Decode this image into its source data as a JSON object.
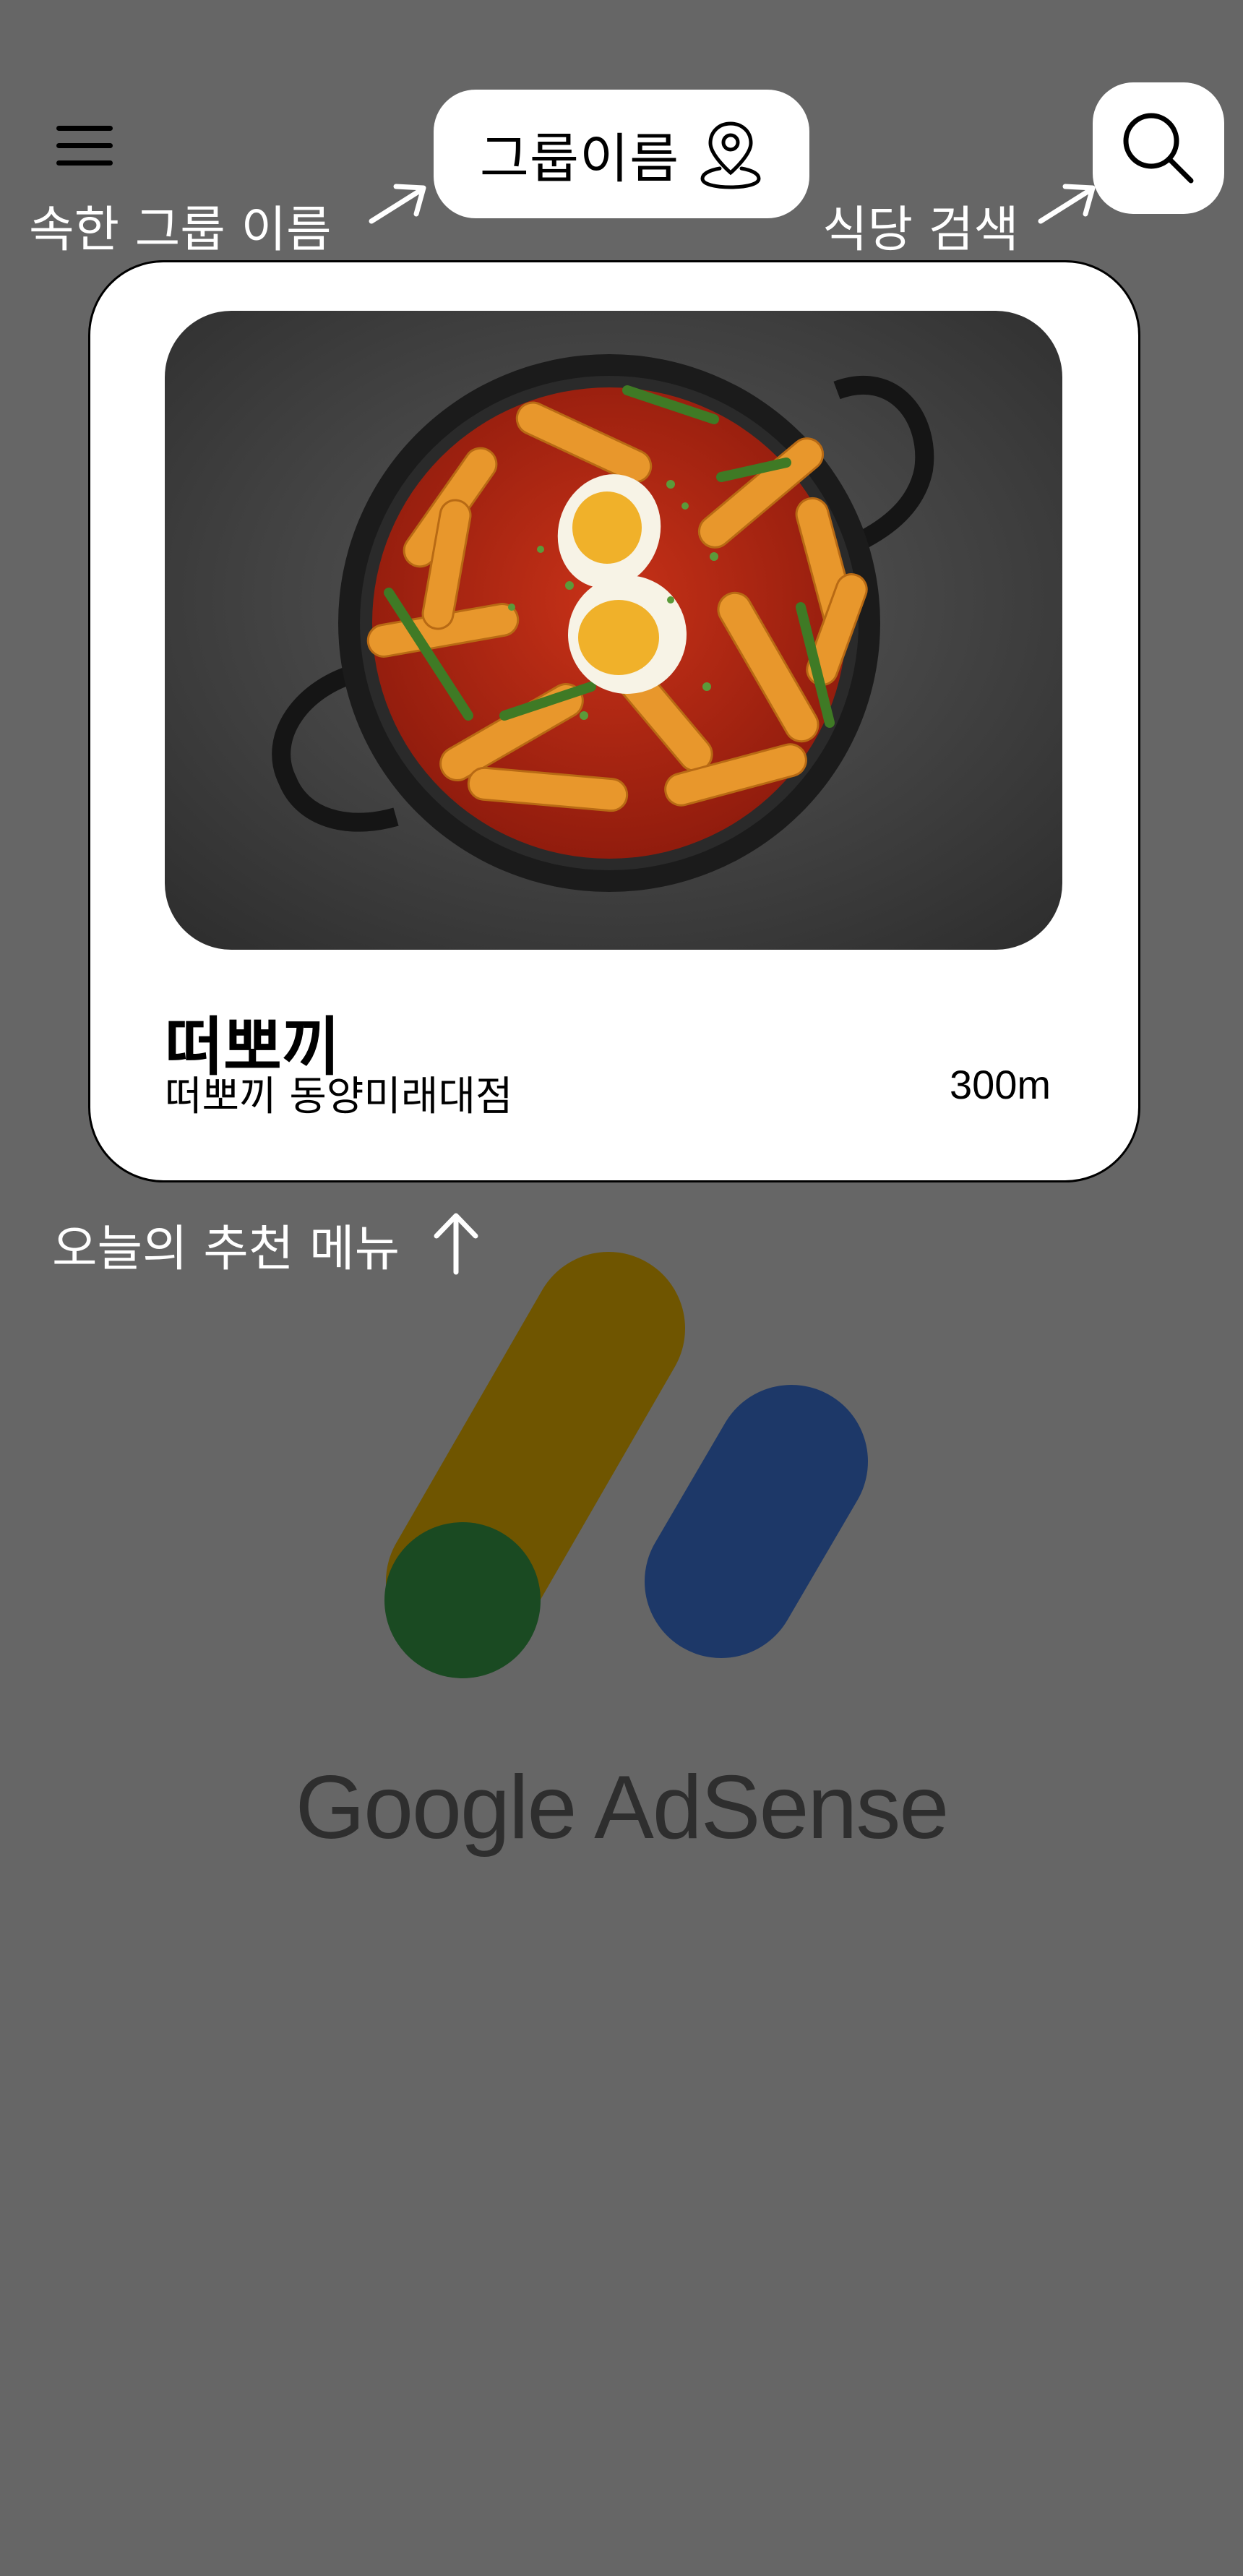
{
  "header": {
    "group_name": "그룹이름",
    "group_annotation": "속한 그룹 이름",
    "search_annotation": "식당 검색"
  },
  "recommendation": {
    "title": "떠뽀끼",
    "store": "떠뽀끼 동양미래대점",
    "distance": "300m",
    "annotation": "오늘의 추천 메뉴"
  },
  "ad": {
    "label": "Google AdSense",
    "colors": {
      "yellow": "#6f5500",
      "green": "#1a4a22",
      "blue": "#1d3868"
    }
  },
  "icons": [
    "hamburger-menu-icon",
    "location-pin-icon",
    "search-icon"
  ],
  "colors": {
    "background": "#666666",
    "card": "#ffffff",
    "annotation_text": "#ffffff"
  }
}
